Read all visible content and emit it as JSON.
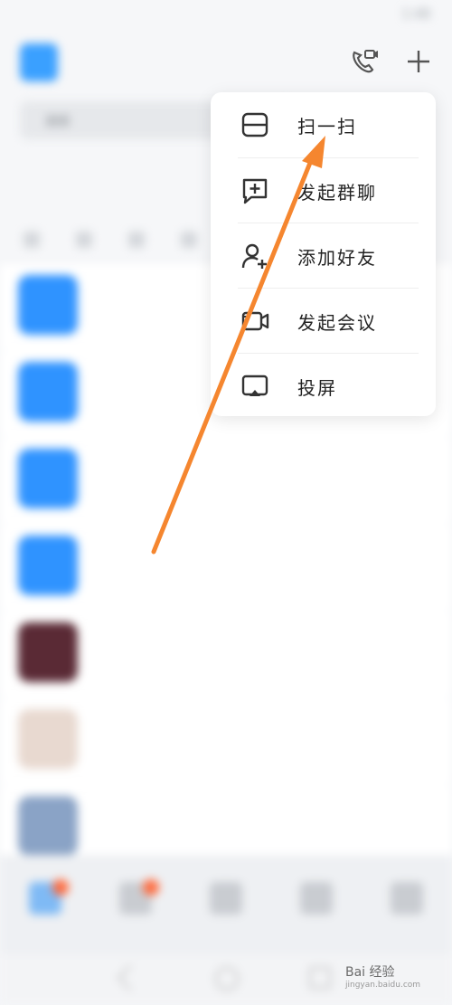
{
  "statusbar": {
    "carrier": "",
    "time": "1:48"
  },
  "header": {
    "workspace_name": ""
  },
  "search": {
    "placeholder": "搜索"
  },
  "tabs": [
    {
      "label": ""
    },
    {
      "label": ""
    }
  ],
  "chats": [
    {
      "name": "",
      "preview": "",
      "time": "",
      "avatar_color": "#2f93ff"
    },
    {
      "name": "",
      "preview": "",
      "time": "",
      "avatar_color": "#2f93ff"
    },
    {
      "name": "",
      "preview": "",
      "time": "",
      "avatar_color": "#2f93ff"
    },
    {
      "name": "",
      "preview": "",
      "time": "",
      "avatar_color": "#2f93ff"
    },
    {
      "name": "",
      "preview": "",
      "time": "",
      "avatar_color": "#5a2a35"
    },
    {
      "name": "",
      "preview": "",
      "time": "",
      "avatar_color": "#e8d9d0"
    },
    {
      "name": "",
      "preview": "",
      "time": "",
      "avatar_color": "#8aa3c6"
    }
  ],
  "menu": {
    "items": [
      {
        "label": "扫一扫",
        "icon": "scan-icon"
      },
      {
        "label": "发起群聊",
        "icon": "new-group-chat-icon"
      },
      {
        "label": "添加好友",
        "icon": "add-friend-icon"
      },
      {
        "label": "发起会议",
        "icon": "video-meeting-icon"
      },
      {
        "label": "投屏",
        "icon": "screen-cast-icon"
      }
    ]
  },
  "annotation": {
    "arrow_color": "#f5862f"
  },
  "watermark": {
    "text": "Bai 经验",
    "sub": "jingyan.baidu.com"
  },
  "colors": {
    "accent": "#2f93ff",
    "badge": "#ff6a3d"
  }
}
